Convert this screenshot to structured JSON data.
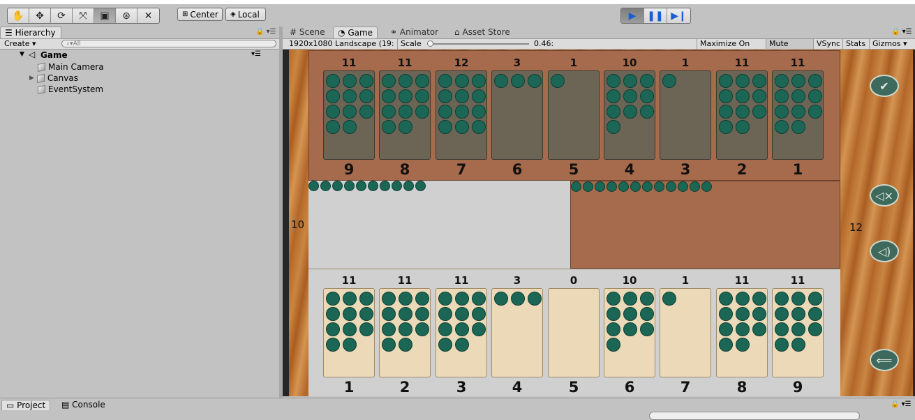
{
  "toolbar": {
    "tools": [
      "hand-tool",
      "move-tool",
      "rotate-tool",
      "scale-tool",
      "rect-tool",
      "transform-tool",
      "custom-tool"
    ],
    "pivot_center": "Center",
    "pivot_local": "Local",
    "play": "play-icon",
    "pause": "pause-icon",
    "step": "step-icon"
  },
  "hierarchy": {
    "tab_label": "Hierarchy",
    "create_label": "Create",
    "search_placeholder": "All",
    "scene_name": "Game",
    "items": [
      {
        "label": "Main Camera",
        "has_children": false
      },
      {
        "label": "Canvas",
        "has_children": true
      },
      {
        "label": "EventSystem",
        "has_children": false
      }
    ]
  },
  "editor_tabs": [
    "Scene",
    "Game",
    "Animator",
    "Asset Store"
  ],
  "game_controls": {
    "resolution": "1920x1080 Landscape (19:",
    "scale_label": "Scale",
    "scale_value": "0.46:",
    "scale_fraction": 0.0,
    "maximize": "Maximize On Play",
    "mute": "Mute Audio",
    "vsync": "VSync",
    "stats": "Stats",
    "gizmos": "Gizmos"
  },
  "game": {
    "top_counts": [
      "11",
      "11",
      "12",
      "3",
      "1",
      "10",
      "1",
      "11",
      "11"
    ],
    "top_indices": [
      "9",
      "8",
      "7",
      "6",
      "5",
      "4",
      "3",
      "2",
      "1"
    ],
    "bottom_counts": [
      "11",
      "11",
      "11",
      "3",
      "0",
      "10",
      "1",
      "11",
      "11"
    ],
    "bottom_indices": [
      "1",
      "2",
      "3",
      "4",
      "5",
      "6",
      "7",
      "8",
      "9"
    ],
    "left_store": "10",
    "right_store": "12",
    "left_store_stones": 10,
    "right_store_stones": 12,
    "buttons": [
      "check-icon",
      "mute-icon",
      "sound-icon",
      "back-arrow-icon"
    ]
  },
  "bottom_tabs": [
    "Project",
    "Console"
  ]
}
